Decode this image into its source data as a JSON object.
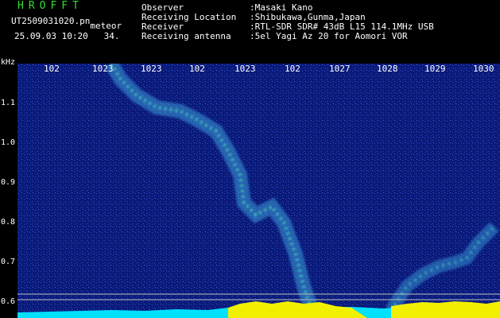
{
  "app_title": "HROFFT",
  "file": {
    "name": "UT2509031020.pn",
    "tag": "meteor"
  },
  "timestamp": {
    "date_time": "25.09.03 10:20",
    "extra": "34."
  },
  "info": [
    {
      "label": "Observer",
      "value": ":Masaki Kano"
    },
    {
      "label": "Receiving Location",
      "value": ":Shibukawa,Gunma,Japan"
    },
    {
      "label": "Receiver",
      "value": ":RTL-SDR SDR# 43dB L15 114.1MHz USB"
    },
    {
      "label": "Receiving antenna",
      "value": ":5el Yagi Az 20 for Aomori VOR"
    }
  ],
  "y_axis": {
    "unit": "kHz",
    "ticks": [
      {
        "label": "1.1",
        "value": 1.1
      },
      {
        "label": "1.0",
        "value": 1.0
      },
      {
        "label": "0.9",
        "value": 0.9
      },
      {
        "label": "0.8",
        "value": 0.8
      },
      {
        "label": "0.7",
        "value": 0.7
      },
      {
        "label": "0.6",
        "value": 0.6
      }
    ]
  },
  "x_axis": {
    "ticks": [
      "102",
      "1023",
      "1023",
      "102",
      "1023",
      "102",
      "1027",
      "1028",
      "1029",
      "1030"
    ]
  },
  "colors": {
    "background": "#0a1a78",
    "noise": "#2c4cd0",
    "signal": "#50e8c0",
    "baseline_yellow": "#f0f000",
    "baseline_cyan": "#00e0ff"
  }
}
